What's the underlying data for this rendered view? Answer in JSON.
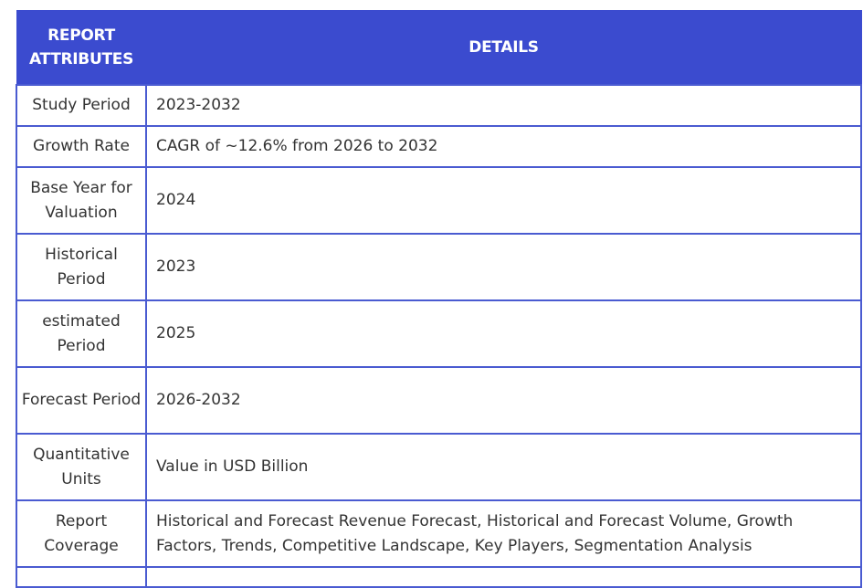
{
  "table": {
    "header": {
      "attribute_col": "REPORT ATTRIBUTES",
      "details_col": "DETAILS"
    },
    "rows": [
      {
        "attribute": "Study Period",
        "details": "2023-2032"
      },
      {
        "attribute": "Growth Rate",
        "details": "CAGR of ~12.6% from 2026 to 2032"
      },
      {
        "attribute": "Base Year for Valuation",
        "details": "2024"
      },
      {
        "attribute": "Historical Period",
        "details": "2023"
      },
      {
        "attribute": "estimated Period",
        "details": "2025"
      },
      {
        "attribute": "Forecast Period",
        "details": "2026-2032"
      },
      {
        "attribute": "Quantitative Units",
        "details": "Value in USD Billion"
      },
      {
        "attribute": "Report Coverage",
        "details": "Historical and Forecast Revenue Forecast, Historical and Forecast Volume, Growth Factors, Trends, Competitive Landscape, Key Players, Segmentation Analysis"
      }
    ]
  },
  "colors": {
    "header_bg": "#3b4bcf",
    "border": "#4a5bd1",
    "text": "#333333"
  }
}
